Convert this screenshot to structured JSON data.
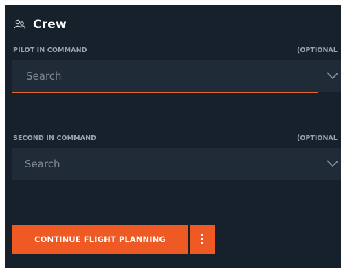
{
  "section": {
    "title": "Crew",
    "icon": "crew-icon"
  },
  "pilot_in_command": {
    "label": "PILOT IN COMMAND",
    "optional_label": "(OPTIONAL",
    "placeholder": "Search",
    "focused": true
  },
  "second_in_command": {
    "label": "SECOND IN COMMAND",
    "optional_label": "(OPTIONAL",
    "placeholder": "Search",
    "focused": false
  },
  "actions": {
    "continue_label": "CONTINUE FLIGHT PLANNING",
    "more_icon": "more-vertical-icon"
  },
  "colors": {
    "panel_background": "#16212c",
    "field_background": "#1f2b37",
    "accent": "#ef5a24",
    "focus_underline": "#e8642c"
  }
}
